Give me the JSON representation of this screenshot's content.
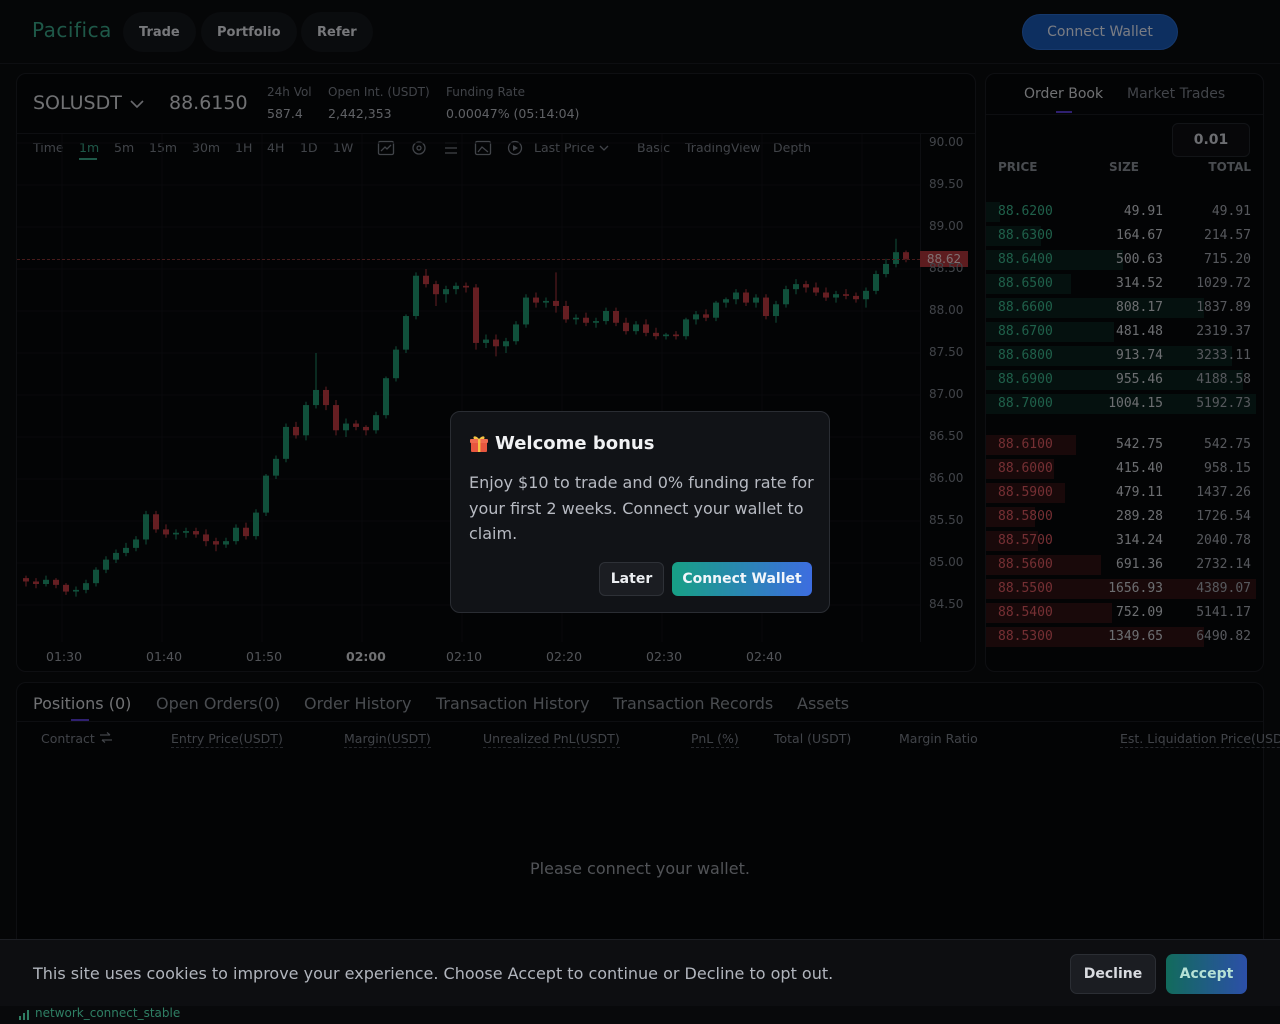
{
  "header": {
    "logo": "Pacifica",
    "nav": [
      "Trade",
      "Portfolio",
      "Refer"
    ],
    "connect_wallet": "Connect Wallet"
  },
  "symbol": {
    "name": "SOLUSDT",
    "price": "88.6150",
    "stats": [
      {
        "label": "24h Vol",
        "value": "587.4"
      },
      {
        "label": "Open Int. (USDT)",
        "value": "2,442,353"
      },
      {
        "label": "Funding Rate",
        "value": "0.00047% (05:14:04)"
      }
    ]
  },
  "toolbar": {
    "timeframes": [
      "Time",
      "1m",
      "5m",
      "15m",
      "30m",
      "1H",
      "4H",
      "1D",
      "1W"
    ],
    "active_timeframe": "1m",
    "price_type": "Last Price",
    "views": [
      "Basic",
      "TradingView",
      "Depth"
    ]
  },
  "chart_data": {
    "type": "candlestick",
    "y_ticks": [
      "90.00",
      "89.50",
      "89.00",
      "88.50",
      "88.00",
      "87.50",
      "87.00",
      "86.50",
      "86.00",
      "85.50",
      "85.00",
      "84.50"
    ],
    "x_ticks": [
      "01:30",
      "01:40",
      "01:50",
      "02:00",
      "02:10",
      "02:20",
      "02:30",
      "02:40"
    ],
    "ylim": [
      84.2,
      90.1
    ],
    "current_price": "88.62",
    "candles": [
      [
        84.82,
        84.85,
        84.72,
        84.78
      ],
      [
        84.78,
        84.82,
        84.7,
        84.75
      ],
      [
        84.75,
        84.85,
        84.72,
        84.8
      ],
      [
        84.8,
        84.82,
        84.7,
        84.74
      ],
      [
        84.74,
        84.76,
        84.62,
        84.66
      ],
      [
        84.66,
        84.72,
        84.6,
        84.68
      ],
      [
        84.68,
        84.8,
        84.64,
        84.76
      ],
      [
        84.76,
        84.95,
        84.72,
        84.92
      ],
      [
        84.92,
        85.08,
        84.88,
        85.04
      ],
      [
        85.04,
        85.16,
        85.0,
        85.12
      ],
      [
        85.12,
        85.24,
        85.08,
        85.18
      ],
      [
        85.18,
        85.32,
        85.14,
        85.28
      ],
      [
        85.28,
        85.62,
        85.22,
        85.58
      ],
      [
        85.58,
        85.62,
        85.36,
        85.4
      ],
      [
        85.4,
        85.46,
        85.3,
        85.34
      ],
      [
        85.34,
        85.4,
        85.28,
        85.36
      ],
      [
        85.36,
        85.42,
        85.3,
        85.38
      ],
      [
        85.38,
        85.42,
        85.3,
        85.34
      ],
      [
        85.34,
        85.4,
        85.2,
        85.26
      ],
      [
        85.26,
        85.3,
        85.14,
        85.22
      ],
      [
        85.22,
        85.3,
        85.18,
        85.26
      ],
      [
        85.26,
        85.46,
        85.22,
        85.42
      ],
      [
        85.42,
        85.48,
        85.28,
        85.32
      ],
      [
        85.32,
        85.64,
        85.28,
        85.6
      ],
      [
        85.6,
        86.06,
        85.56,
        86.04
      ],
      [
        86.04,
        86.28,
        86.0,
        86.24
      ],
      [
        86.24,
        86.66,
        86.2,
        86.62
      ],
      [
        86.62,
        86.68,
        86.48,
        86.52
      ],
      [
        86.52,
        86.92,
        86.46,
        86.88
      ],
      [
        86.88,
        87.5,
        86.84,
        87.06
      ],
      [
        87.06,
        87.1,
        86.82,
        86.88
      ],
      [
        86.88,
        86.94,
        86.52,
        86.58
      ],
      [
        86.58,
        86.72,
        86.5,
        86.66
      ],
      [
        86.66,
        86.7,
        86.58,
        86.62
      ],
      [
        86.62,
        86.64,
        86.52,
        86.58
      ],
      [
        86.58,
        86.8,
        86.54,
        86.76
      ],
      [
        86.76,
        87.22,
        86.72,
        87.2
      ],
      [
        87.2,
        87.58,
        87.16,
        87.54
      ],
      [
        87.54,
        87.96,
        87.5,
        87.94
      ],
      [
        87.94,
        88.46,
        87.9,
        88.42
      ],
      [
        88.42,
        88.5,
        88.28,
        88.32
      ],
      [
        88.32,
        88.36,
        88.06,
        88.2
      ],
      [
        88.2,
        88.3,
        88.1,
        88.26
      ],
      [
        88.26,
        88.34,
        88.2,
        88.3
      ],
      [
        88.3,
        88.34,
        88.22,
        88.28
      ],
      [
        88.28,
        88.32,
        87.54,
        87.62
      ],
      [
        87.62,
        87.72,
        87.56,
        87.66
      ],
      [
        87.66,
        87.72,
        87.46,
        87.58
      ],
      [
        87.58,
        87.68,
        87.5,
        87.64
      ],
      [
        87.64,
        87.88,
        87.6,
        87.84
      ],
      [
        87.84,
        88.2,
        87.8,
        88.16
      ],
      [
        88.16,
        88.22,
        88.04,
        88.1
      ],
      [
        88.1,
        88.16,
        88.04,
        88.12
      ],
      [
        88.12,
        88.46,
        87.98,
        88.06
      ],
      [
        88.06,
        88.12,
        87.86,
        87.9
      ],
      [
        87.9,
        87.96,
        87.84,
        87.92
      ],
      [
        87.92,
        87.98,
        87.82,
        87.86
      ],
      [
        87.86,
        87.92,
        87.8,
        87.88
      ],
      [
        87.88,
        88.04,
        87.84,
        88.0
      ],
      [
        88.0,
        88.04,
        87.82,
        87.86
      ],
      [
        87.86,
        87.92,
        87.72,
        87.76
      ],
      [
        87.76,
        87.88,
        87.72,
        87.84
      ],
      [
        87.84,
        87.9,
        87.7,
        87.74
      ],
      [
        87.74,
        87.8,
        87.66,
        87.7
      ],
      [
        87.7,
        87.74,
        87.66,
        87.72
      ],
      [
        87.72,
        87.76,
        87.66,
        87.7
      ],
      [
        87.7,
        87.92,
        87.66,
        87.9
      ],
      [
        87.9,
        88.0,
        87.84,
        87.96
      ],
      [
        87.96,
        88.02,
        87.88,
        87.92
      ],
      [
        87.92,
        88.12,
        87.88,
        88.1
      ],
      [
        88.1,
        88.16,
        88.04,
        88.14
      ],
      [
        88.14,
        88.26,
        88.08,
        88.22
      ],
      [
        88.22,
        88.26,
        88.06,
        88.1
      ],
      [
        88.1,
        88.2,
        88.04,
        88.16
      ],
      [
        88.16,
        88.2,
        87.9,
        87.94
      ],
      [
        87.94,
        88.12,
        87.86,
        88.08
      ],
      [
        88.08,
        88.3,
        88.04,
        88.26
      ],
      [
        88.26,
        88.38,
        88.2,
        88.32
      ],
      [
        88.32,
        88.36,
        88.22,
        88.28
      ],
      [
        88.28,
        88.34,
        88.18,
        88.22
      ],
      [
        88.22,
        88.28,
        88.12,
        88.16
      ],
      [
        88.16,
        88.24,
        88.1,
        88.2
      ],
      [
        88.2,
        88.26,
        88.14,
        88.18
      ],
      [
        88.18,
        88.22,
        88.1,
        88.14
      ],
      [
        88.14,
        88.28,
        88.04,
        88.24
      ],
      [
        88.24,
        88.48,
        88.2,
        88.44
      ],
      [
        88.44,
        88.62,
        88.4,
        88.56
      ],
      [
        88.56,
        88.86,
        88.52,
        88.7
      ],
      [
        88.7,
        88.72,
        88.58,
        88.62
      ]
    ]
  },
  "orderbook": {
    "tabs": [
      "Order Book",
      "Market Trades"
    ],
    "tick": "0.01",
    "headers": [
      "PRICE",
      "SIZE",
      "TOTAL"
    ],
    "asks": [
      {
        "price": "88.6200",
        "size": "49.91",
        "total": "49.91",
        "fill": 0.05
      },
      {
        "price": "88.6300",
        "size": "164.67",
        "total": "214.57",
        "fill": 0.2
      },
      {
        "price": "88.6400",
        "size": "500.63",
        "total": "715.20",
        "fill": 0.5
      },
      {
        "price": "88.6500",
        "size": "314.52",
        "total": "1029.72",
        "fill": 0.31
      },
      {
        "price": "88.6600",
        "size": "808.17",
        "total": "1837.89",
        "fill": 0.8
      },
      {
        "price": "88.6700",
        "size": "481.48",
        "total": "2319.37",
        "fill": 0.47
      },
      {
        "price": "88.6800",
        "size": "913.74",
        "total": "3233.11",
        "fill": 0.9
      },
      {
        "price": "88.6900",
        "size": "955.46",
        "total": "4188.58",
        "fill": 0.94
      },
      {
        "price": "88.7000",
        "size": "1004.15",
        "total": "5192.73",
        "fill": 0.99
      }
    ],
    "bids": [
      {
        "price": "88.6100",
        "size": "542.75",
        "total": "542.75",
        "fill": 0.33
      },
      {
        "price": "88.6000",
        "size": "415.40",
        "total": "958.15",
        "fill": 0.25
      },
      {
        "price": "88.5900",
        "size": "479.11",
        "total": "1437.26",
        "fill": 0.29
      },
      {
        "price": "88.5800",
        "size": "289.28",
        "total": "1726.54",
        "fill": 0.18
      },
      {
        "price": "88.5700",
        "size": "314.24",
        "total": "2040.78",
        "fill": 0.19
      },
      {
        "price": "88.5600",
        "size": "691.36",
        "total": "2732.14",
        "fill": 0.42
      },
      {
        "price": "88.5500",
        "size": "1656.93",
        "total": "4389.07",
        "fill": 0.99
      },
      {
        "price": "88.5400",
        "size": "752.09",
        "total": "5141.17",
        "fill": 0.46
      },
      {
        "price": "88.5300",
        "size": "1349.65",
        "total": "6490.82",
        "fill": 0.8
      }
    ]
  },
  "positions": {
    "tabs": [
      "Positions (0)",
      "Open Orders(0)",
      "Order History",
      "Transaction History",
      "Transaction Records",
      "Assets"
    ],
    "columns": [
      "Contract",
      "Entry Price(USDT)",
      "Margin(USDT)",
      "Unrealized PnL(USDT)",
      "PnL (%)",
      "Total (USDT)",
      "Margin Ratio",
      "Est. Liquidation Price(USDT)"
    ],
    "empty": "Please connect your wallet."
  },
  "modal": {
    "title": "Welcome bonus",
    "body": "Enjoy $10 to trade and 0% funding rate for your first 2 weeks. Connect your wallet to claim.",
    "later": "Later",
    "connect": "Connect Wallet"
  },
  "cookie": {
    "text": "This site uses cookies to improve your experience. Choose Accept to continue or Decline to opt out.",
    "decline": "Decline",
    "accept": "Accept"
  },
  "status": {
    "text": "network_connect_stable"
  },
  "colors": {
    "up": "#1f9a72",
    "down": "#c23a42",
    "accent": "#3ba98a"
  }
}
